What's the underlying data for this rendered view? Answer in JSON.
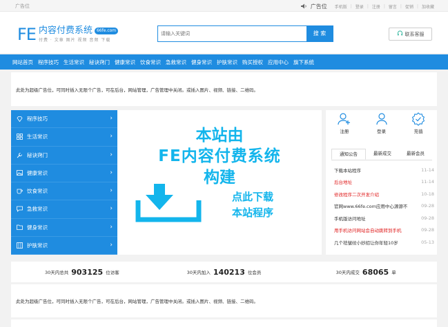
{
  "topbar": {
    "ad": "广告位",
    "ad_position": "广告位",
    "links": [
      "手机版",
      "登录",
      "注册",
      "留言",
      "促销",
      "加收藏"
    ]
  },
  "header": {
    "logo_fe": "FE",
    "site_name": "内容付费系统",
    "badge": "66fe.com",
    "subtitle": "付费 · 文章 图片 视频 音频 下载",
    "search_placeholder": "请输入关键词",
    "search_button": "搜 索",
    "service_label": "联系客服"
  },
  "nav": [
    "网站首页",
    "程序技巧",
    "生活常识",
    "秘诀窍门",
    "健康常识",
    "饮食常识",
    "急救常识",
    "健身常识",
    "护肤常识",
    "购买授权",
    "应用中心",
    "旗下系统"
  ],
  "ad_text": "此处为超级广告位，可同时插入无限个广告，可在后台，网站管理，广告管理中关闭。或插入图片、视频、链接、二维码。",
  "sidebar": [
    {
      "label": "程序技巧",
      "icon": "diamond-icon"
    },
    {
      "label": "生活常识",
      "icon": "grid-icon"
    },
    {
      "label": "秘诀窍门",
      "icon": "wrench-icon"
    },
    {
      "label": "健康常识",
      "icon": "image-icon"
    },
    {
      "label": "饮食常识",
      "icon": "cup-icon"
    },
    {
      "label": "急救常识",
      "icon": "chat-icon"
    },
    {
      "label": "健身常识",
      "icon": "folder-icon"
    },
    {
      "label": "护肤常识",
      "icon": "film-icon"
    }
  ],
  "banner": {
    "line1": "本站由",
    "line2": "FE内容付费系统",
    "line3": "构建",
    "download1": "点此下载",
    "download2": "本站程序"
  },
  "actions": [
    {
      "label": "注册",
      "icon": "user-add-icon"
    },
    {
      "label": "登录",
      "icon": "user-icon"
    },
    {
      "label": "充值",
      "icon": "badge-check-icon"
    }
  ],
  "tabs": [
    "通知公告",
    "最新成交",
    "最新会员"
  ],
  "notices": [
    {
      "text": "下载本站程序",
      "date": "11-14",
      "color": "#333333"
    },
    {
      "text": "后台地址",
      "date": "11-14",
      "color": "#e02020"
    },
    {
      "text": "修改程序二次开发介绍",
      "date": "10-18",
      "color": "#e02020"
    },
    {
      "text": "官网www.66fe.com应用中心源源不",
      "date": "09-28",
      "color": "#333333"
    },
    {
      "text": "手机版访问地址",
      "date": "09-28",
      "color": "#333333"
    },
    {
      "text": "用手机访问网站会自动跳转到手机",
      "date": "09-28",
      "color": "#e02020"
    },
    {
      "text": "几个祛皱纹小妙招让你年轻10岁",
      "date": "05-13",
      "color": "#333333"
    }
  ],
  "stats": [
    {
      "prefix": "30天内总共",
      "value": "903125",
      "suffix": "位访客"
    },
    {
      "prefix": "30天内加入",
      "value": "140213",
      "suffix": "位会员"
    },
    {
      "prefix": "30天内成交",
      "value": "68065",
      "suffix": "单"
    }
  ],
  "colors": {
    "primary": "#1f8ce0",
    "banner": "#13b5ec",
    "highlight": "#e02020"
  }
}
